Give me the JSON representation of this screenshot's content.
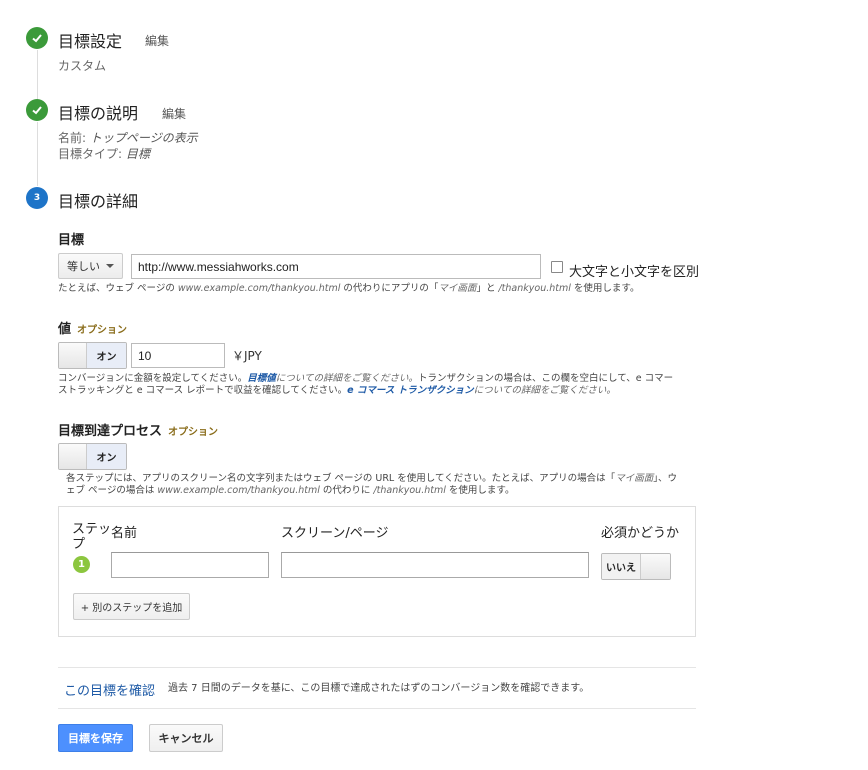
{
  "steps": [
    {
      "title": "目標設定",
      "edit": "編集",
      "summary": "カスタム"
    },
    {
      "title": "目標の説明",
      "edit": "編集",
      "name_label": "名前:",
      "name_value": "トップページの表示",
      "type_label": "目標タイプ:",
      "type_value": "目標"
    },
    {
      "number": "3",
      "title": "目標の詳細"
    }
  ],
  "destination": {
    "label": "目標",
    "match_type": "等しい",
    "url_value": "http://www.messiahworks.com",
    "case_sensitive_label": "大文字と小文字を区別",
    "help_prefix": "たとえば、ウェブ ページの",
    "help_example": "www.example.com/thankyou.html",
    "help_mid": "の代わりにアプリの「",
    "help_app": "マイ画面",
    "help_and": "」と",
    "help_path": "/thankyou.html",
    "help_suffix": "を使用します。"
  },
  "value": {
    "label": "値",
    "optional": "オプション",
    "toggle_label": "オン",
    "amount": "10",
    "currency": "￥JPY",
    "help_line1_a": "コンバージョンに金額を設定してください。",
    "help_link1": "目標値",
    "help_line1_b": "についての詳細をご覧ください。",
    "help_line1_c": "トランザクションの場合は、この欄を空白にして、e コマー",
    "help_line2_a": "ストラッキングと e コマース レポートで収益を確認してください。",
    "help_link2": "e コマース トランザクション",
    "help_line2_b": "についての詳細をご覧ください。"
  },
  "funnel": {
    "label": "目標到達プロセス",
    "optional": "オプション",
    "toggle_label": "オン",
    "help_line1": "各ステップには、アプリのスクリーン名の文字列またはウェブ ページの URL を使用してください。たとえば、アプリの場合は「",
    "help_line1_app": "マイ画面",
    "help_line1_end": "」、ウ",
    "help_line2_a": "ェブ ページの場合は",
    "help_line2_example": "www.example.com/thankyou.html",
    "help_line2_mid": "の代わりに",
    "help_line2_path": "/thankyou.html",
    "help_line2_end": "を使用します。",
    "columns": {
      "step_line1": "ステッ",
      "step_line2": "プ",
      "name": "名前",
      "screen": "スクリーン/ページ",
      "required": "必須かどうか"
    },
    "rows": [
      {
        "number": "1",
        "name": "",
        "screen": "",
        "required": "いいえ"
      }
    ],
    "add_step": "+ 別のステップを追加"
  },
  "verify": {
    "link": "この目標を確認",
    "description": "過去 7 日間のデータを基に、この目標で達成されたはずのコンバージョン数を確認できます。"
  },
  "actions": {
    "save": "目標を保存",
    "cancel": "キャンセル"
  },
  "colors": {
    "step_done": "#3b9a3a",
    "step_active": "#1e74c8",
    "primary_button": "#4d90fe",
    "funnel_step_badge": "#8cc63f",
    "optional_label": "#8a6d1b"
  }
}
